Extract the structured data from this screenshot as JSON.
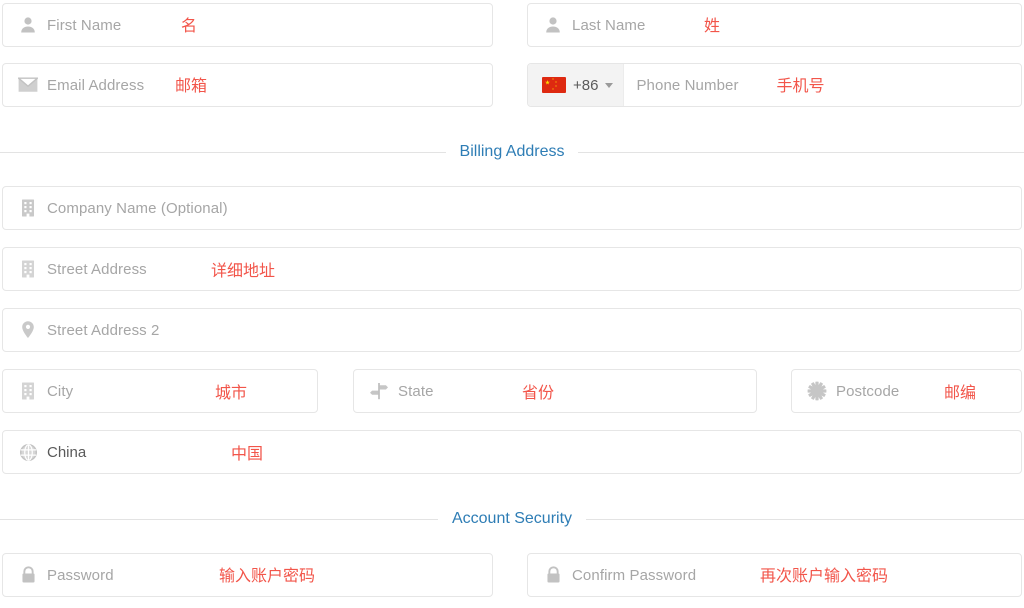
{
  "colors": {
    "annotation_red": "#f2554a",
    "section_blue": "#2e7db5",
    "placeholder_gray": "#a6a6a6",
    "border_gray": "#e6e6e6",
    "flag_red": "#de2910",
    "flag_yellow": "#ffde00"
  },
  "fields": {
    "first_name": {
      "placeholder": "First Name",
      "annotation": "名",
      "icon": "user-icon"
    },
    "last_name": {
      "placeholder": "Last Name",
      "annotation": "姓",
      "icon": "user-icon"
    },
    "email": {
      "placeholder": "Email Address",
      "annotation": "邮箱",
      "icon": "envelope-icon"
    },
    "phone": {
      "placeholder": "Phone Number",
      "annotation": "手机号",
      "dial_code": "+86",
      "flag": "china-flag-icon",
      "caret": "chevron-down-icon"
    },
    "company": {
      "placeholder": "Company Name (Optional)",
      "annotation": "",
      "icon": "building-icon"
    },
    "street_address": {
      "placeholder": "Street Address",
      "annotation": "详细地址",
      "icon": "building-icon"
    },
    "street_address_2": {
      "placeholder": "Street Address 2",
      "annotation": "",
      "icon": "map-pin-icon"
    },
    "city": {
      "placeholder": "City",
      "annotation": "城市",
      "icon": "building-icon"
    },
    "state": {
      "placeholder": "State",
      "annotation": "省份",
      "icon": "signpost-icon"
    },
    "postcode": {
      "placeholder": "Postcode",
      "annotation": "邮编",
      "icon": "gear-icon"
    },
    "country": {
      "value": "China",
      "annotation": "中国",
      "icon": "globe-icon"
    },
    "password": {
      "placeholder": "Password",
      "annotation": "输入账户密码",
      "icon": "lock-icon"
    },
    "confirm_password": {
      "placeholder": "Confirm Password",
      "annotation": "再次账户输入密码",
      "icon": "lock-icon"
    }
  },
  "sections": {
    "billing_address": "Billing Address",
    "account_security": "Account Security"
  }
}
